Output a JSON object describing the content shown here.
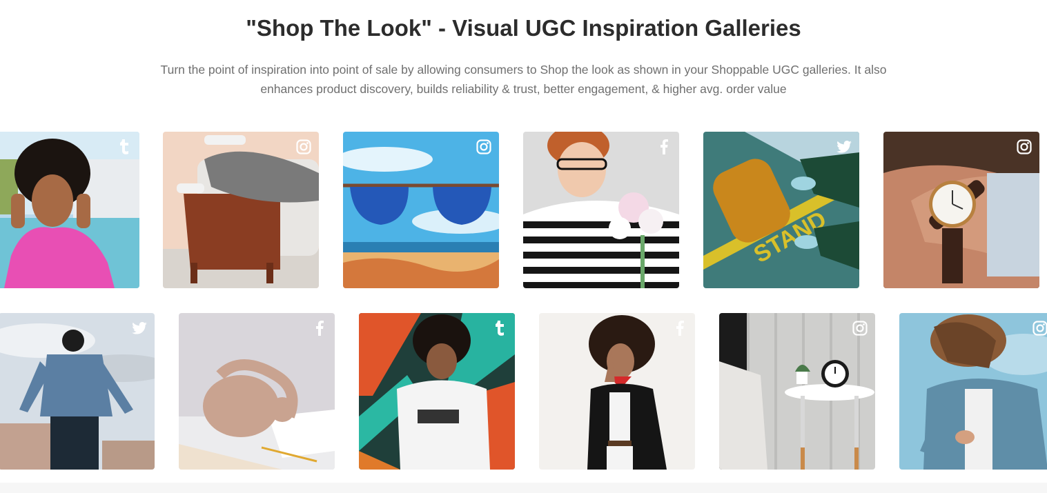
{
  "header": {
    "title": "\"Shop The Look\" - Visual UGC Inspiration Galleries",
    "subtitle": "Turn the point of inspiration into point of sale by allowing consumers to Shop the look as shown in your Shoppable UGC galleries. It also enhances product discovery, builds reliability & trust, better engagement, & higher avg. order value"
  },
  "gallery": {
    "row1": [
      {
        "subject": "woman-pink-jacket",
        "network": "tumblr-icon"
      },
      {
        "subject": "person-on-armchair",
        "network": "instagram-icon"
      },
      {
        "subject": "sunglasses-beach",
        "network": "instagram-icon"
      },
      {
        "subject": "woman-striped-shirt-flowers",
        "network": "facebook-icon"
      },
      {
        "subject": "yellow-bag-stand",
        "network": "twitter-icon"
      },
      {
        "subject": "wrist-watch",
        "network": "instagram-icon"
      }
    ],
    "row2": [
      {
        "subject": "man-denim-jacket",
        "network": "twitter-icon"
      },
      {
        "subject": "beige-handbag",
        "network": "facebook-icon"
      },
      {
        "subject": "man-graffiti-wall",
        "network": "tumblr-icon"
      },
      {
        "subject": "woman-black-blazer",
        "network": "facebook-icon"
      },
      {
        "subject": "alarm-clock-table",
        "network": "instagram-icon"
      },
      {
        "subject": "woman-denim-jacket",
        "network": "instagram-icon"
      }
    ]
  },
  "colors": {
    "title": "#2c2c2c",
    "subtitle": "#6f6f6f",
    "icon": "#ffffff"
  }
}
